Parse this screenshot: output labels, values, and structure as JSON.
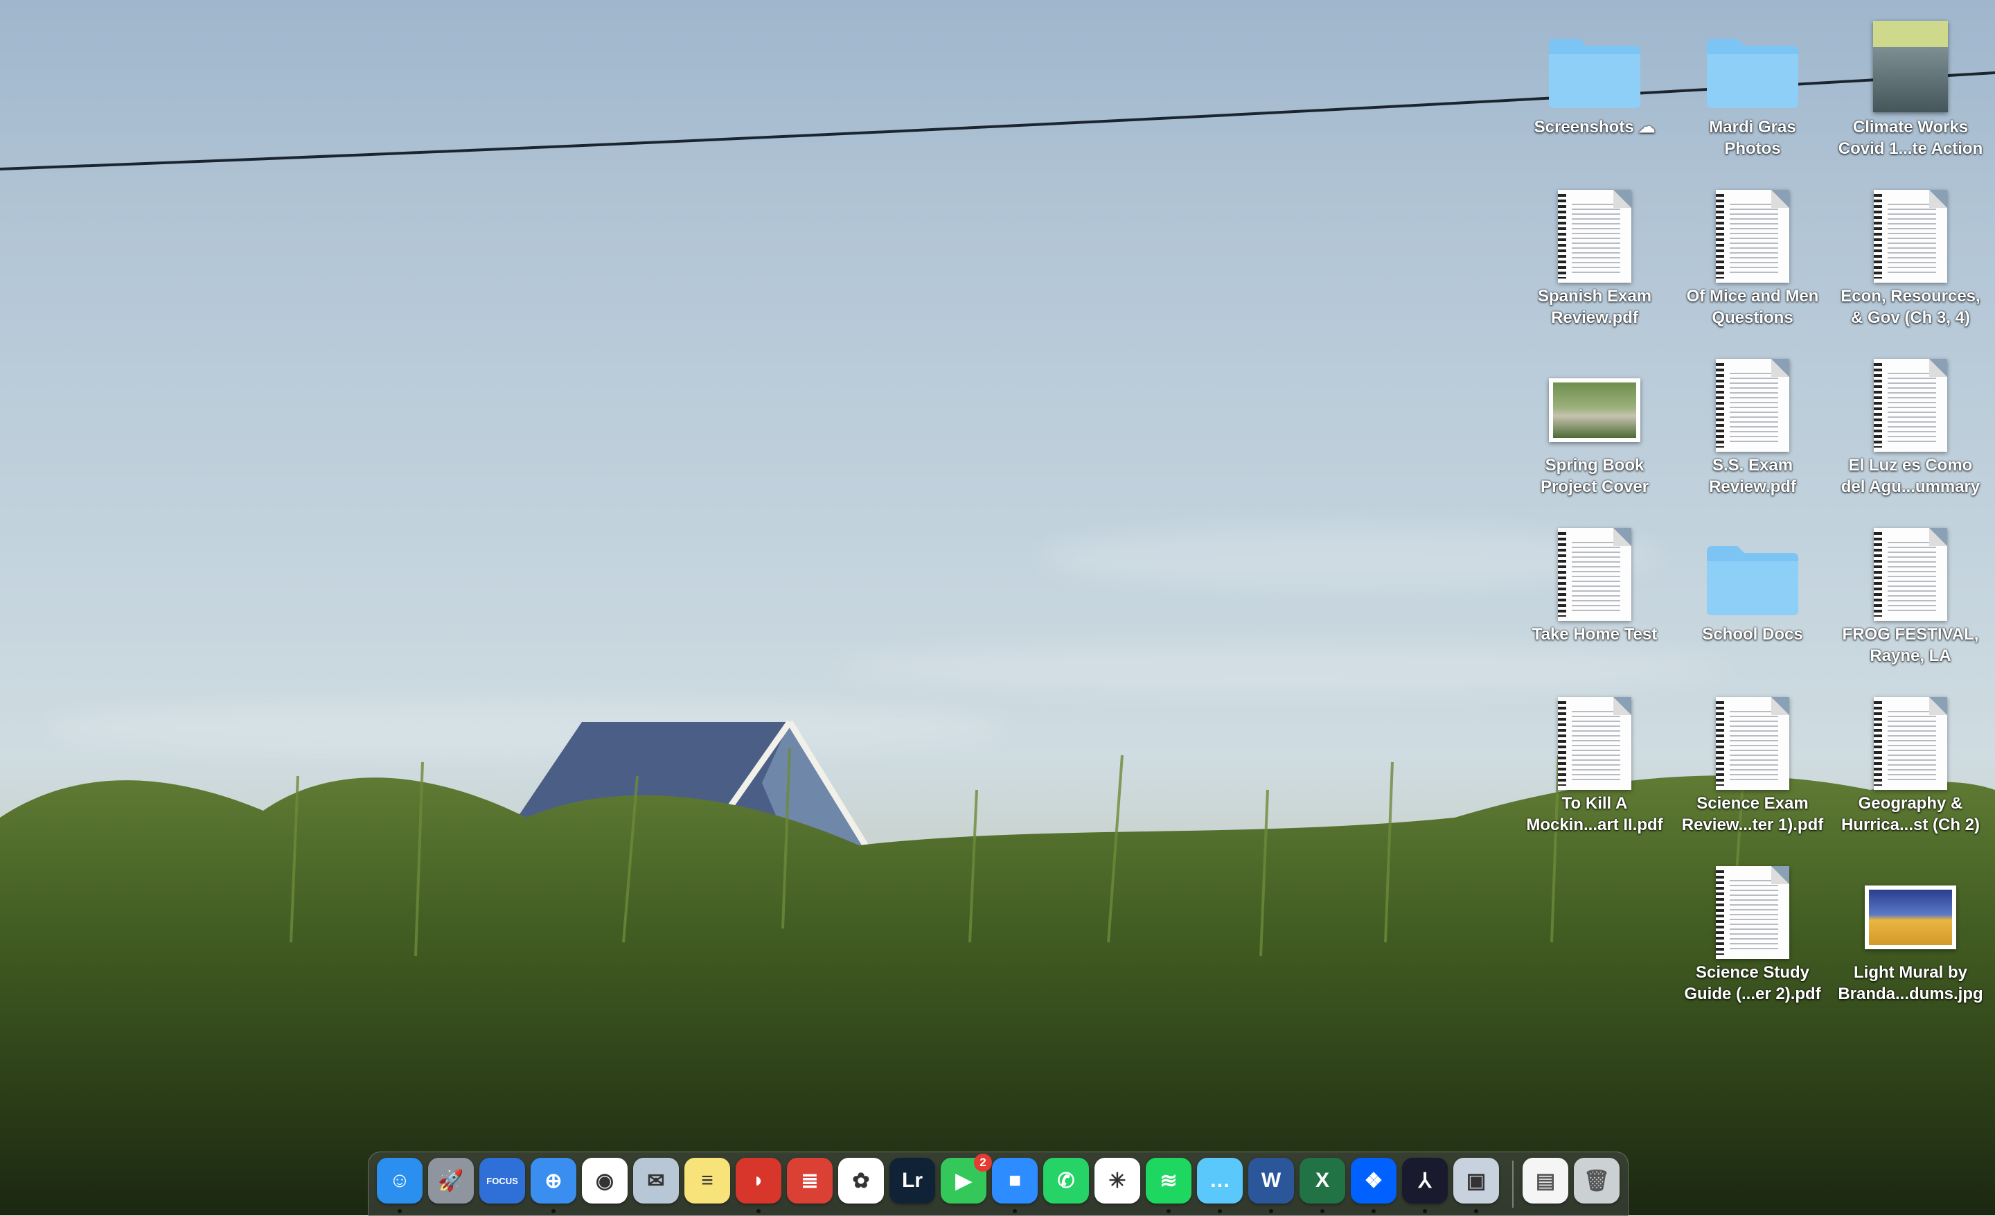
{
  "desktop": {
    "icons": [
      {
        "label": "Screenshots ☁",
        "type": "folder"
      },
      {
        "label": "Mardi Gras\nPhotos",
        "type": "folder"
      },
      {
        "label": "Climate Works\nCovid 1...te Action",
        "type": "cover"
      },
      {
        "label": "Spanish Exam\nReview.pdf",
        "type": "document"
      },
      {
        "label": "Of Mice and Men\nQuestions",
        "type": "document"
      },
      {
        "label": "Econ, Resources,\n& Gov (Ch 3, 4)",
        "type": "document"
      },
      {
        "label": "Spring Book\nProject Cover",
        "type": "photo"
      },
      {
        "label": "S.S. Exam\nReview.pdf",
        "type": "document"
      },
      {
        "label": "El Luz es Como\ndel Agu...ummary",
        "type": "document"
      },
      {
        "label": "Take Home Test",
        "type": "document"
      },
      {
        "label": "School Docs",
        "type": "folder"
      },
      {
        "label": "FROG FESTIVAL,\nRayne, LA",
        "type": "document"
      },
      {
        "label": "To Kill A\nMockin...art II.pdf",
        "type": "document"
      },
      {
        "label": "Science Exam\nReview...ter 1).pdf",
        "type": "document"
      },
      {
        "label": "Geography &\nHurrica...st (Ch 2)",
        "type": "document"
      },
      {
        "label": "Science Study\nGuide (...er 2).pdf",
        "type": "document"
      },
      {
        "label": "Light Mural by\nBranda...dums.jpg",
        "type": "photo"
      }
    ]
  },
  "dock": {
    "apps": [
      {
        "name": "Finder",
        "icon": "finder-icon",
        "color": "#2b8ff0",
        "glyph": "☺",
        "running": true
      },
      {
        "name": "Launchpad",
        "icon": "rocket-icon",
        "color": "#8e959e",
        "glyph": "🚀",
        "running": false
      },
      {
        "name": "Focus",
        "icon": "focus-icon",
        "color": "#2f6fd8",
        "glyph": "FOCUS",
        "running": false
      },
      {
        "name": "Safari",
        "icon": "compass-icon",
        "color": "#3a8ef0",
        "glyph": "⊕",
        "running": true
      },
      {
        "name": "Chrome",
        "icon": "chrome-icon",
        "color": "#ffffff",
        "glyph": "◉",
        "running": false
      },
      {
        "name": "Mail",
        "icon": "stamp-icon",
        "color": "#b7c7d6",
        "glyph": "✉",
        "running": false
      },
      {
        "name": "Notes",
        "icon": "notes-icon",
        "color": "#f8e27a",
        "glyph": "≡",
        "running": false
      },
      {
        "name": "Bear",
        "icon": "bear-icon",
        "color": "#d9362b",
        "glyph": "◗",
        "running": true
      },
      {
        "name": "Todoist",
        "icon": "todoist-icon",
        "color": "#db4035",
        "glyph": "≣",
        "running": false
      },
      {
        "name": "Photos",
        "icon": "photos-icon",
        "color": "#ffffff",
        "glyph": "✿",
        "running": false
      },
      {
        "name": "Lightroom",
        "icon": "lightroom-icon",
        "color": "#0f2236",
        "glyph": "Lr",
        "running": false
      },
      {
        "name": "FaceTime",
        "icon": "facetime-icon",
        "color": "#34c759",
        "glyph": "▶",
        "running": false,
        "badge": "2"
      },
      {
        "name": "Zoom",
        "icon": "zoom-icon",
        "color": "#2d8cff",
        "glyph": "■",
        "running": true
      },
      {
        "name": "WhatsApp",
        "icon": "whatsapp-icon",
        "color": "#25d366",
        "glyph": "✆",
        "running": false
      },
      {
        "name": "Slack",
        "icon": "slack-icon",
        "color": "#ffffff",
        "glyph": "✳",
        "running": false
      },
      {
        "name": "Spotify",
        "icon": "spotify-icon",
        "color": "#1ed760",
        "glyph": "≋",
        "running": true
      },
      {
        "name": "Messages",
        "icon": "messages-icon",
        "color": "#5ac8fa",
        "glyph": "…",
        "running": true
      },
      {
        "name": "Word",
        "icon": "word-icon",
        "color": "#2b579a",
        "glyph": "W",
        "running": true
      },
      {
        "name": "Excel",
        "icon": "excel-icon",
        "color": "#217346",
        "glyph": "X",
        "running": true
      },
      {
        "name": "Dropbox",
        "icon": "dropbox-icon",
        "color": "#0061fe",
        "glyph": "❖",
        "running": true
      },
      {
        "name": "Acrobat",
        "icon": "acrobat-icon",
        "color": "#1a1a2e",
        "glyph": "⅄",
        "running": true
      },
      {
        "name": "Preview",
        "icon": "preview-icon",
        "color": "#c8d2de",
        "glyph": "▣",
        "running": true
      }
    ],
    "recent": [
      {
        "name": "Document",
        "icon": "document-icon"
      },
      {
        "name": "Trash",
        "icon": "trash-icon"
      }
    ]
  }
}
